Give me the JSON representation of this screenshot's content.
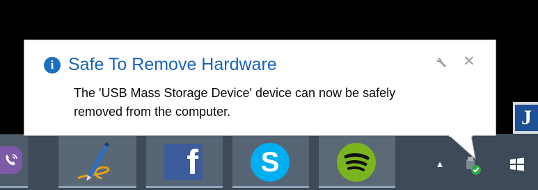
{
  "notification": {
    "title": "Safe To Remove Hardware",
    "message_line1": "The 'USB Mass Storage Device' device can now be safely",
    "message_line2": "removed from the computer.",
    "info_icon": "info-icon",
    "options_icon": "wrench-icon",
    "close_icon": "close-icon",
    "close_glyph": "✕",
    "info_glyph": "i",
    "title_color": "#1b63b8"
  },
  "taskbar": {
    "background": "#3e4a57",
    "pinned_apps": [
      {
        "name": "Viber",
        "icon": "viber-icon"
      },
      {
        "name": "Pen app",
        "icon": "pen-icon"
      },
      {
        "name": "Facebook",
        "icon": "facebook-icon",
        "glyph": "f"
      },
      {
        "name": "Skype",
        "icon": "skype-icon",
        "glyph": "S"
      },
      {
        "name": "Spotify",
        "icon": "spotify-icon"
      }
    ],
    "tray": {
      "chevron_glyph": "▲",
      "usb_icon": "safely-remove-hardware-icon",
      "start_icon": "windows-logo-icon"
    },
    "corner_app_glyph": "J"
  }
}
